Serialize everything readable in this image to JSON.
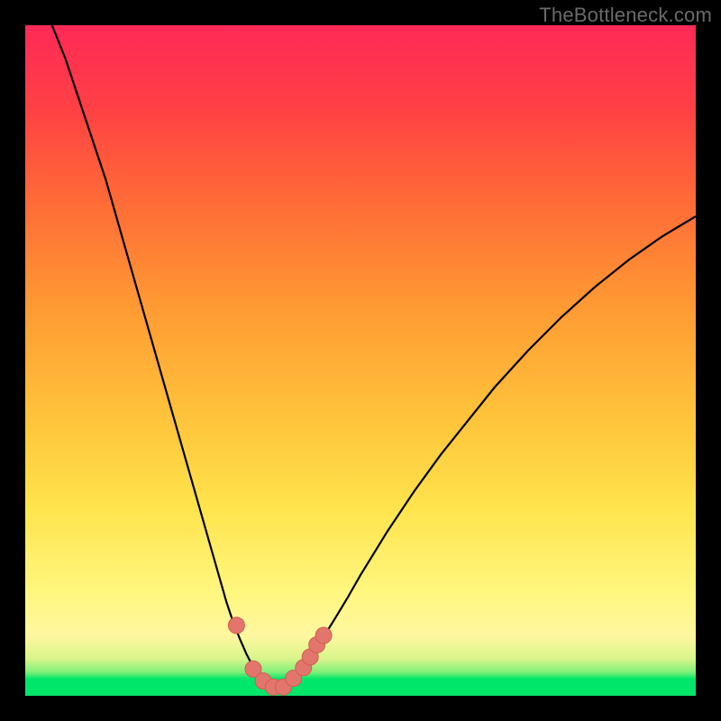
{
  "watermark": {
    "text": "TheBottleneck.com"
  },
  "colors": {
    "page_bg": "#000000",
    "curve_stroke": "#000000",
    "marker_fill": "#e2766c",
    "marker_stroke": "#d45c53",
    "gradient_stops": [
      "#00e66a",
      "#7df07a",
      "#d8f58a",
      "#fff7a0",
      "#fff780",
      "#ffe44d",
      "#ffc23a",
      "#ff9a33",
      "#ff6a37",
      "#ff3f45",
      "#ff2a57"
    ]
  },
  "chart_data": {
    "type": "line",
    "title": "",
    "xlabel": "",
    "ylabel": "",
    "xlim": [
      0,
      100
    ],
    "ylim": [
      0,
      100
    ],
    "grid": false,
    "legend": false,
    "series": [
      {
        "name": "bottleneck-curve",
        "x": [
          4,
          6,
          8,
          10,
          12,
          14,
          16,
          18,
          20,
          22,
          24,
          26,
          28,
          30,
          31,
          32,
          33,
          34,
          35,
          36,
          37,
          38,
          39,
          40,
          42,
          44,
          46,
          48,
          50,
          54,
          58,
          62,
          66,
          70,
          75,
          80,
          85,
          90,
          95,
          100
        ],
        "y": [
          100,
          95,
          89,
          83,
          77,
          70,
          63,
          56,
          49,
          42,
          35,
          28,
          21,
          14,
          11,
          8.5,
          6.2,
          4.3,
          2.8,
          1.8,
          1.3,
          1.3,
          1.8,
          2.6,
          5,
          8,
          11.2,
          14.5,
          18,
          24.5,
          30.5,
          36,
          41,
          46,
          51.5,
          56.5,
          61,
          65,
          68.5,
          71.5
        ]
      }
    ],
    "markers": {
      "name": "highlight-points",
      "x": [
        31.5,
        34,
        35.5,
        37,
        38.5,
        40,
        41.5,
        42.5,
        43.5,
        44.5
      ],
      "y": [
        10.5,
        4.0,
        2.2,
        1.3,
        1.3,
        2.6,
        4.2,
        5.8,
        7.6,
        9.0
      ]
    }
  }
}
